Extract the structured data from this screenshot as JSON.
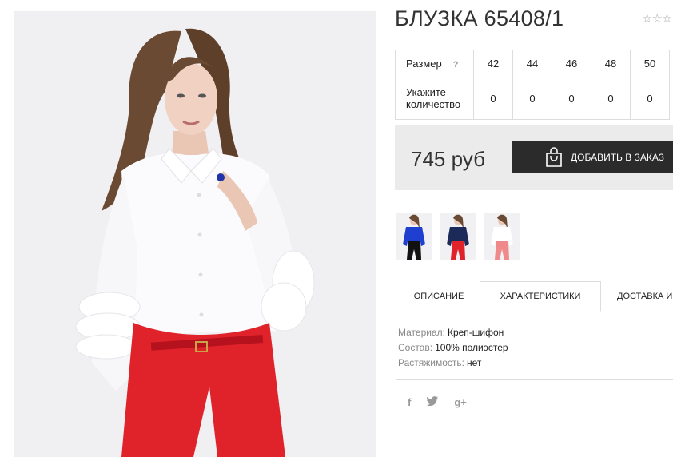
{
  "product": {
    "title": "БЛУЗКА 65408/1",
    "rating_stars": "☆☆☆"
  },
  "sizes": {
    "size_label": "Размер",
    "help": "?",
    "qty_label_1": "Укажите",
    "qty_label_2": "количество",
    "values": [
      "42",
      "44",
      "46",
      "48",
      "50"
    ],
    "quantities": [
      "0",
      "0",
      "0",
      "0",
      "0"
    ]
  },
  "purchase": {
    "price": "745 руб",
    "add_button": "ДОБАВИТЬ В ЗАКАЗ"
  },
  "thumbnails": [
    {
      "name": "blue-blouse"
    },
    {
      "name": "navy-blouse"
    },
    {
      "name": "white-blouse"
    }
  ],
  "tabs": {
    "description": "ОПИСАНИЕ",
    "specs": "ХАРАКТЕРИСТИКИ",
    "delivery": "ДОСТАВКА И"
  },
  "specs": [
    {
      "key": "Материал:",
      "value": "Креп-шифон"
    },
    {
      "key": "Состав:",
      "value": "100% полиэстер"
    },
    {
      "key": "Растяжимость:",
      "value": "нет"
    }
  ],
  "social": {
    "facebook": "f",
    "twitter": "🐦",
    "google": "g+"
  },
  "colors": {
    "button_bg": "#2b2b2b",
    "price_bg": "#ebebeb",
    "pants_red": "#e0222a",
    "blouse_white": "#fbfbfd"
  }
}
